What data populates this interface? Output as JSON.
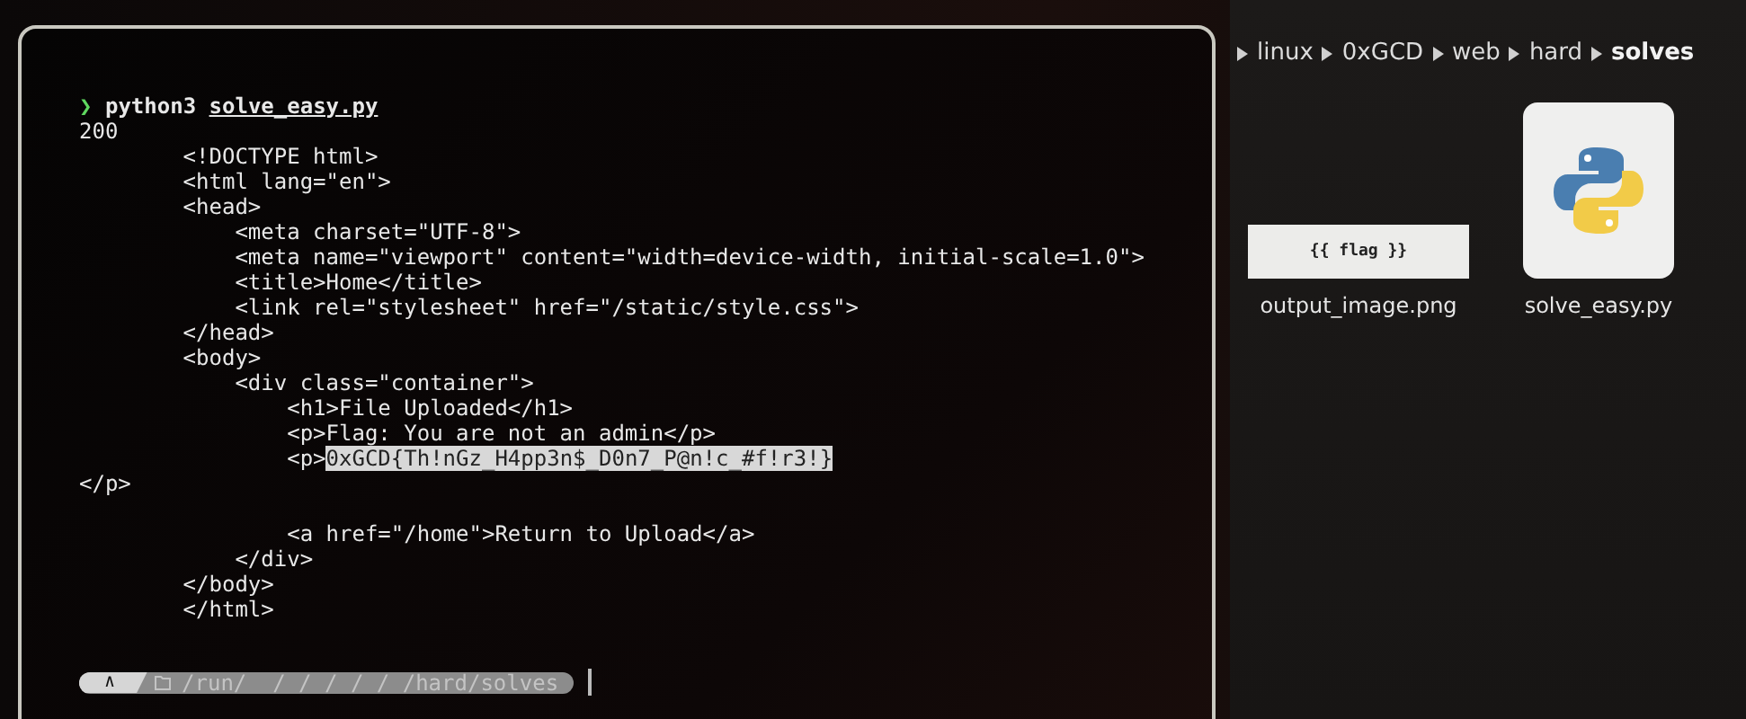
{
  "terminal": {
    "lines": [
      {
        "kind": "prompt",
        "symbol": "❯",
        "command": "python3",
        "argument": "solve_easy.py"
      },
      {
        "kind": "output",
        "text": "200"
      },
      {
        "kind": "output",
        "text": "        <!DOCTYPE html>"
      },
      {
        "kind": "output",
        "text": "        <html lang=\"en\">"
      },
      {
        "kind": "output",
        "text": "        <head>"
      },
      {
        "kind": "output",
        "text": "            <meta charset=\"UTF-8\">"
      },
      {
        "kind": "output",
        "text": "            <meta name=\"viewport\" content=\"width=device-width, initial-scale=1.0\">"
      },
      {
        "kind": "output",
        "text": "            <title>Home</title>"
      },
      {
        "kind": "output",
        "text": "            <link rel=\"stylesheet\" href=\"/static/style.css\">"
      },
      {
        "kind": "output",
        "text": "        </head>"
      },
      {
        "kind": "output",
        "text": "        <body>"
      },
      {
        "kind": "output",
        "text": "            <div class=\"container\">"
      },
      {
        "kind": "output",
        "text": "                <h1>File Uploaded</h1>"
      },
      {
        "kind": "output",
        "text": "                <p>Flag: You are not an admin</p>"
      },
      {
        "kind": "output",
        "text": "                <p>",
        "highlight": "0xGCD{Th!nGz_H4pp3n$_D0n7_P@n!c_#f!r3!}"
      },
      {
        "kind": "output",
        "text": "</p>"
      },
      {
        "kind": "blank"
      },
      {
        "kind": "output",
        "text": "                <a href=\"/home\">Return to Upload</a>"
      },
      {
        "kind": "output",
        "text": "            </div>"
      },
      {
        "kind": "output",
        "text": "        </body>"
      },
      {
        "kind": "output",
        "text": "        </html>"
      }
    ],
    "status_bar": {
      "os_symbol": "∧",
      "path": "/run/  / / / / / /hard/solves"
    }
  },
  "file_manager": {
    "breadcrumb": [
      {
        "label": "linux",
        "selected": false
      },
      {
        "label": "0xGCD",
        "selected": false
      },
      {
        "label": "web",
        "selected": false
      },
      {
        "label": "hard",
        "selected": false
      },
      {
        "label": "solves",
        "selected": true
      }
    ],
    "files": [
      {
        "name": "output_image.png",
        "kind": "image",
        "thumbnail_text": "{{ flag }}"
      },
      {
        "name": "solve_easy.py",
        "kind": "python"
      }
    ]
  }
}
